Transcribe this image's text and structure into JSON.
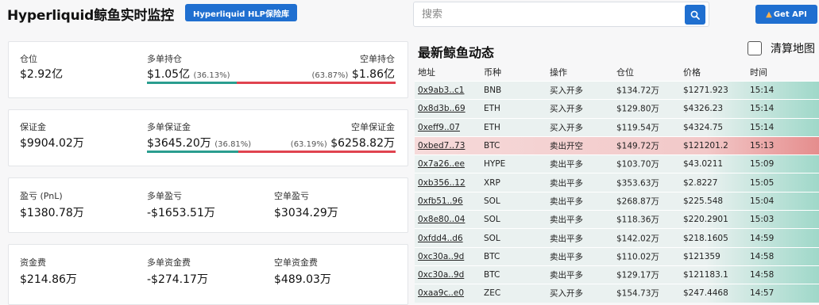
{
  "header": {
    "title": "Hyperliquid鲸鱼实时监控",
    "hlp_button": "Hyperliquid HLP保险库",
    "search_placeholder": "搜索",
    "api_button": "Get API",
    "api_icon": "fire-icon"
  },
  "colors": {
    "accent": "#1f6fd0",
    "long": "#2a9d8f",
    "short": "#e0434f"
  },
  "cards": {
    "position": {
      "total_label": "仓位",
      "total_value": "$2.92亿",
      "long_label": "多单持仓",
      "long_value": "$1.05亿",
      "long_pct": "(36.13%)",
      "short_label": "空单持仓",
      "short_value": "$1.86亿",
      "short_pct": "(63.87%)",
      "long_ratio": 0.3613
    },
    "margin": {
      "total_label": "保证金",
      "total_value": "$9904.02万",
      "long_label": "多单保证金",
      "long_value": "$3645.20万",
      "long_pct": "(36.81%)",
      "short_label": "空单保证金",
      "short_value": "$6258.82万",
      "short_pct": "(63.19%)",
      "long_ratio": 0.3681
    },
    "pnl": {
      "total_label": "盈亏 (PnL)",
      "total_value": "$1380.78万",
      "long_label": "多单盈亏",
      "long_value": "-$1653.51万",
      "short_label": "空单盈亏",
      "short_value": "$3034.29万"
    },
    "funding": {
      "total_label": "资金费",
      "total_value": "$214.86万",
      "long_label": "多单资金费",
      "long_value": "-$274.17万",
      "short_label": "空单资金费",
      "short_value": "$489.03万"
    }
  },
  "feed": {
    "title": "最新鲸鱼动态",
    "clear_label": "清算地图",
    "columns": [
      "地址",
      "币种",
      "操作",
      "仓位",
      "价格",
      "时间"
    ],
    "rows": [
      {
        "addr": "0x9ab3..c1",
        "coin": "BNB",
        "op": "买入开多",
        "size": "$134.72万",
        "price": "$1271.923",
        "time": "15:14",
        "side": "buy"
      },
      {
        "addr": "0x8d3b..69",
        "coin": "ETH",
        "op": "买入开多",
        "size": "$129.80万",
        "price": "$4326.23",
        "time": "15:14",
        "side": "buy"
      },
      {
        "addr": "0xeff9..07",
        "coin": "ETH",
        "op": "买入开多",
        "size": "$119.54万",
        "price": "$4324.75",
        "time": "15:14",
        "side": "buy"
      },
      {
        "addr": "0xbed7..73",
        "coin": "BTC",
        "op": "卖出开空",
        "size": "$149.72万",
        "price": "$121201.2",
        "time": "15:13",
        "side": "sell"
      },
      {
        "addr": "0x7a26..ee",
        "coin": "HYPE",
        "op": "卖出平多",
        "size": "$103.70万",
        "price": "$43.0211",
        "time": "15:09",
        "side": "buy"
      },
      {
        "addr": "0xb356..12",
        "coin": "XRP",
        "op": "卖出平多",
        "size": "$353.63万",
        "price": "$2.8227",
        "time": "15:05",
        "side": "buy"
      },
      {
        "addr": "0xfb51..96",
        "coin": "SOL",
        "op": "卖出平多",
        "size": "$268.87万",
        "price": "$225.548",
        "time": "15:04",
        "side": "buy"
      },
      {
        "addr": "0x8e80..04",
        "coin": "SOL",
        "op": "卖出平多",
        "size": "$118.36万",
        "price": "$220.2901",
        "time": "15:03",
        "side": "buy"
      },
      {
        "addr": "0xfdd4..d6",
        "coin": "SOL",
        "op": "卖出平多",
        "size": "$142.02万",
        "price": "$218.1605",
        "time": "14:59",
        "side": "buy"
      },
      {
        "addr": "0xc30a..9d",
        "coin": "BTC",
        "op": "卖出平多",
        "size": "$110.02万",
        "price": "$121359",
        "time": "14:58",
        "side": "buy"
      },
      {
        "addr": "0xc30a..9d",
        "coin": "BTC",
        "op": "卖出平多",
        "size": "$129.17万",
        "price": "$121183.1",
        "time": "14:58",
        "side": "buy"
      },
      {
        "addr": "0xaa9c..e0",
        "coin": "ZEC",
        "op": "买入开多",
        "size": "$154.73万",
        "price": "$247.4468",
        "time": "14:57",
        "side": "buy"
      }
    ]
  }
}
